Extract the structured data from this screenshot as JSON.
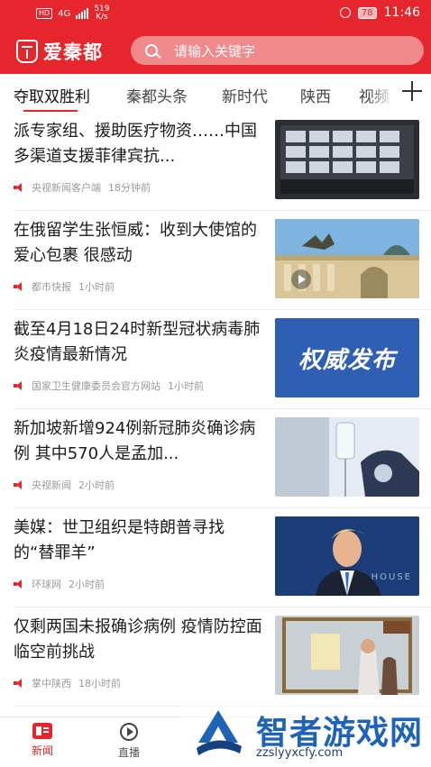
{
  "status_bar": {
    "hd_label": "HD",
    "network": "4G",
    "speed_value": "519",
    "speed_unit": "K/s",
    "battery": "78",
    "time": "11:46"
  },
  "header": {
    "app_name": "爱秦都",
    "search_placeholder": "请输入关键字"
  },
  "tabs": [
    {
      "label": "夺取双胜利"
    },
    {
      "label": "秦都头条"
    },
    {
      "label": "新时代"
    },
    {
      "label": "陕西"
    },
    {
      "label": "视频"
    }
  ],
  "feed": [
    {
      "title": "派专家组、援助医疗物资……中国多渠道支援菲律宾抗...",
      "source": "央视新闻客户端",
      "time": "18分钟前"
    },
    {
      "title": "在俄留学生张恒威：收到大使馆的爱心包裹 很感动",
      "source": "都市快报",
      "time": "1小时前"
    },
    {
      "title": "截至4月18日24时新型冠状病毒肺炎疫情最新情况",
      "source": "国家卫生健康委员会官方网站",
      "time": "1小时前",
      "thumb_text": "权威发布"
    },
    {
      "title": "新加坡新增924例新冠肺炎确诊病例 其中570人是孟加...",
      "source": "央视新闻",
      "time": "2小时前"
    },
    {
      "title": "美媒：世卫组织是特朗普寻找的“替罪羊”",
      "source": "环球网",
      "time": "2小时前",
      "thumb_text": "HOUSE"
    },
    {
      "title": "仅剩两国未报确诊病例 疫情防控面临空前挑战",
      "source": "掌中陕西",
      "time": "18小时前"
    }
  ],
  "bottom_nav": [
    {
      "label": "新闻",
      "icon": "news-icon"
    },
    {
      "label": "直播",
      "icon": "live-play-icon"
    }
  ],
  "watermark": {
    "text": "智者游戏网",
    "url": "zzslyyxcfy.com"
  },
  "colors": {
    "brand_red": "#e5262c",
    "watermark_blue": "#1f63b6"
  }
}
